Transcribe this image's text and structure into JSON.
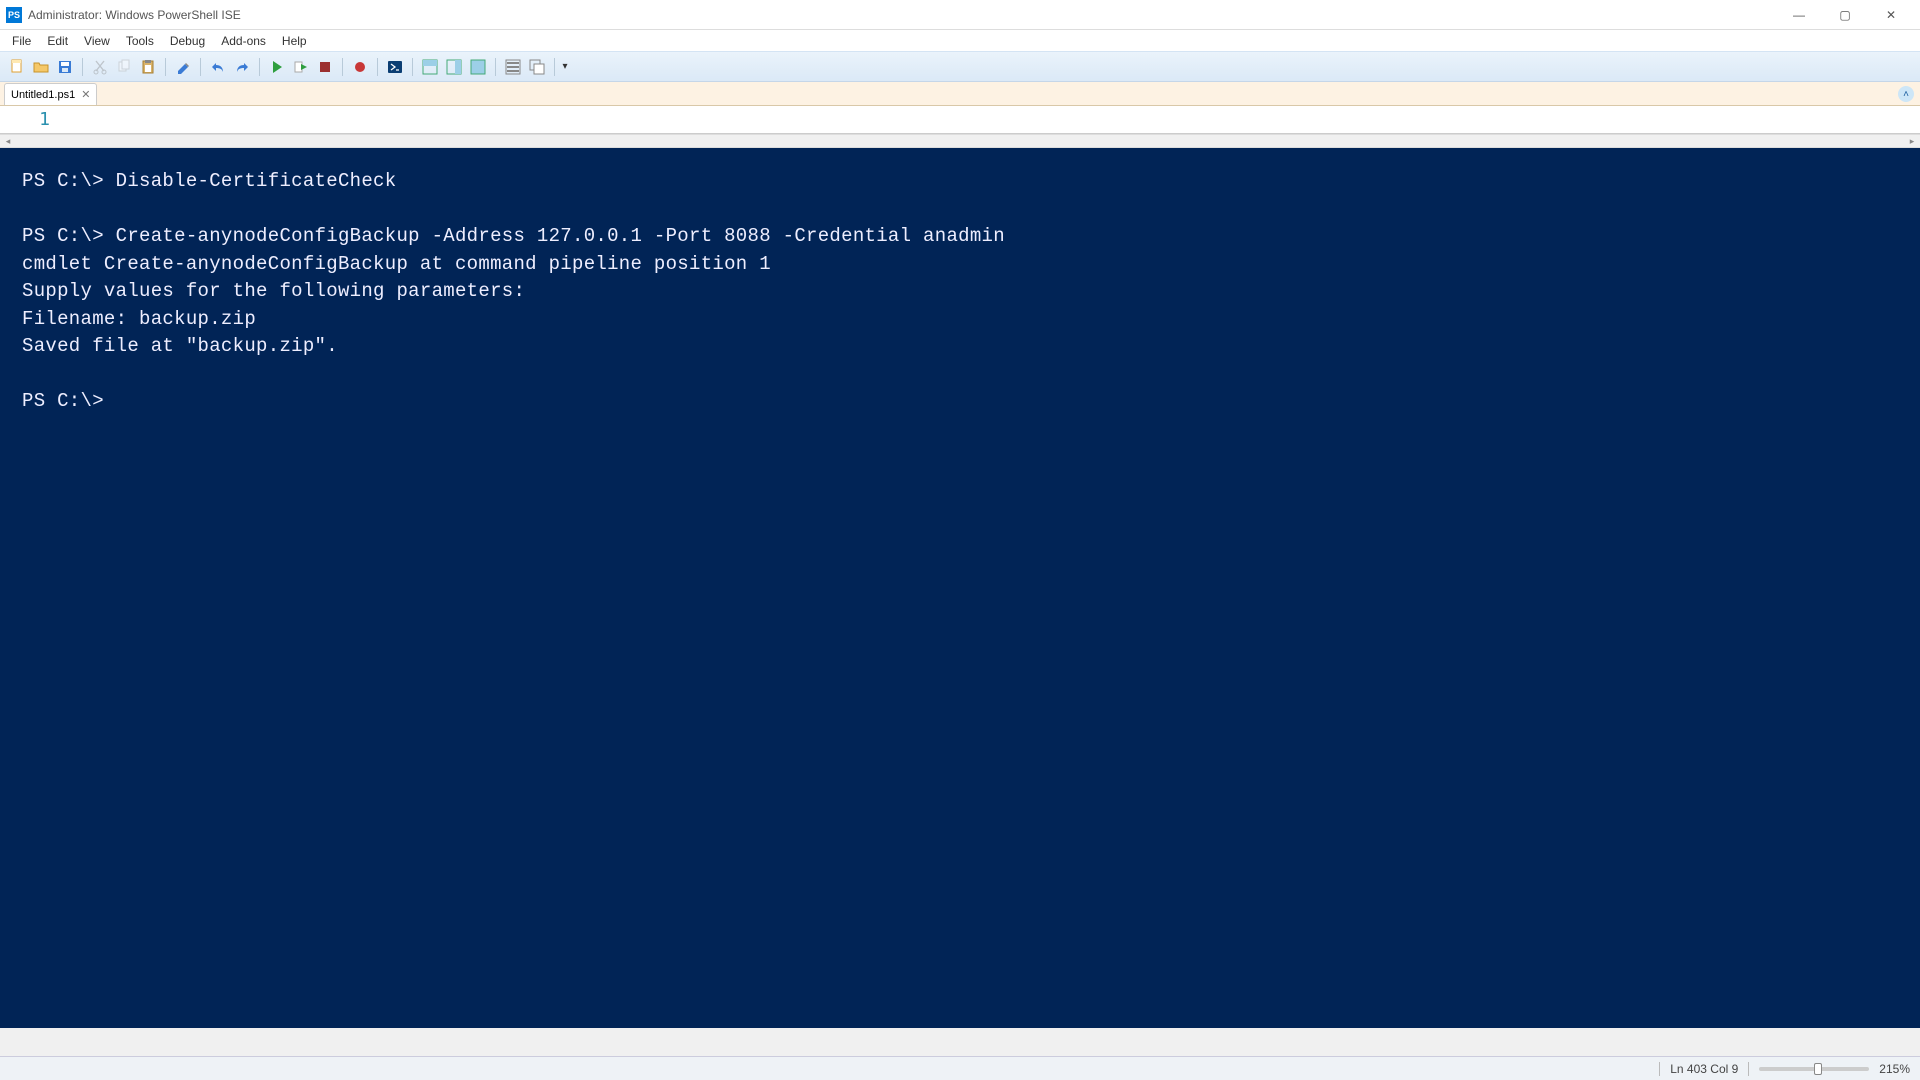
{
  "titlebar": {
    "title": "Administrator: Windows PowerShell ISE",
    "app_icon_label": "PS"
  },
  "window_controls": {
    "minimize": "—",
    "maximize": "▢",
    "close": "✕"
  },
  "menubar": {
    "items": [
      "File",
      "Edit",
      "View",
      "Tools",
      "Debug",
      "Add-ons",
      "Help"
    ]
  },
  "toolbar": {
    "icons": [
      "new-file-icon",
      "open-file-icon",
      "save-icon",
      "sep",
      "cut-icon",
      "copy-icon",
      "paste-icon",
      "sep",
      "clear-icon",
      "sep",
      "undo-icon",
      "redo-icon",
      "sep",
      "run-icon",
      "run-selection-icon",
      "stop-icon",
      "sep",
      "breakpoint-icon",
      "sep",
      "powershell-icon",
      "sep",
      "show-script-top-icon",
      "show-script-right-icon",
      "show-script-max-icon",
      "sep",
      "show-commands-icon",
      "show-command-window-icon",
      "sep",
      "options-icon"
    ]
  },
  "tabs": {
    "active": {
      "label": "Untitled1.ps1",
      "close": "✕"
    },
    "collapse_glyph": "˄"
  },
  "editor": {
    "line_number": "1",
    "content": ""
  },
  "console": {
    "lines": [
      "PS C:\\> Disable-CertificateCheck",
      "",
      "PS C:\\> Create-anynodeConfigBackup -Address 127.0.0.1 -Port 8088 -Credential anadmin",
      "cmdlet Create-anynodeConfigBackup at command pipeline position 1",
      "Supply values for the following parameters:",
      "Filename: backup.zip",
      "Saved file at \"backup.zip\".",
      "",
      "PS C:\\> "
    ]
  },
  "statusbar": {
    "position": "Ln 403  Col 9",
    "zoom": "215%"
  }
}
